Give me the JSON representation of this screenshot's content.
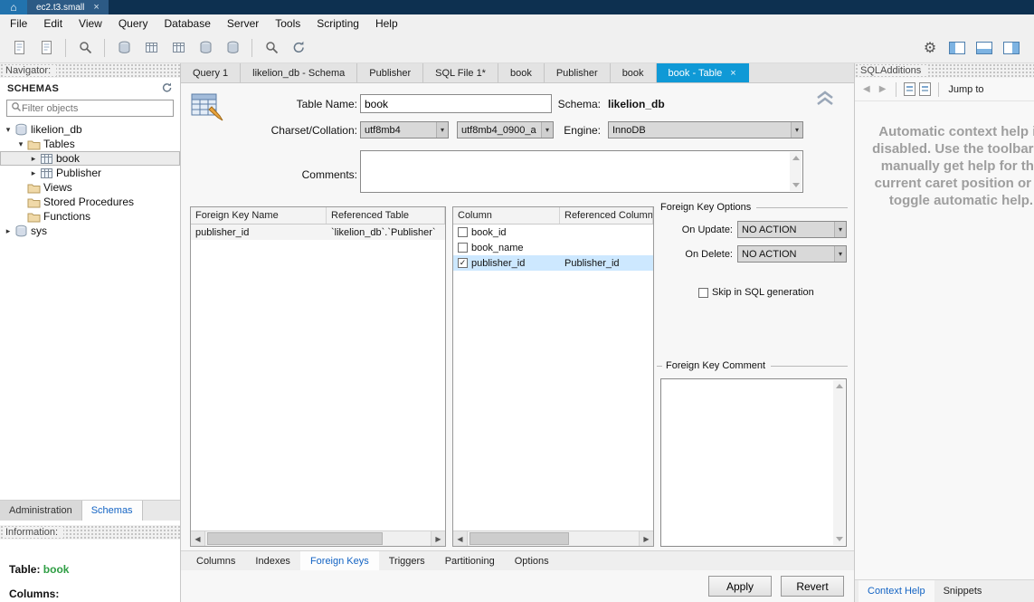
{
  "colors": {
    "titlebar": "#0d3050",
    "accent": "#0f99d6",
    "selection": "#cde8ff",
    "link": "#1464c4",
    "green": "#2f9e44"
  },
  "window": {
    "home_glyph": "⌂",
    "title_tab": "ec2.t3.small",
    "close_glyph": "×"
  },
  "menubar": {
    "items": [
      "File",
      "Edit",
      "View",
      "Query",
      "Database",
      "Server",
      "Tools",
      "Scripting",
      "Help"
    ]
  },
  "toolbar": {
    "left_icons": [
      {
        "name": "new-query-tab-icon",
        "glyph": "page"
      },
      {
        "name": "open-sql-script-icon",
        "glyph": "page"
      },
      {
        "separator": true
      },
      {
        "name": "inspect-database-icon",
        "glyph": "magnifier"
      },
      {
        "separator": true
      },
      {
        "name": "create-schema-icon",
        "glyph": "cylinder"
      },
      {
        "name": "create-table-icon",
        "glyph": "table"
      },
      {
        "name": "create-view-icon",
        "glyph": "table"
      },
      {
        "name": "create-procedure-icon",
        "glyph": "cylinder"
      },
      {
        "name": "create-function-icon",
        "glyph": "cylinder"
      },
      {
        "separator": true
      },
      {
        "name": "search-table-data-icon",
        "glyph": "magnifier"
      },
      {
        "name": "reconnect-dbms-icon",
        "glyph": "refresh"
      }
    ],
    "right_icons": [
      {
        "name": "preferences-gear-icon",
        "glyph": "gear"
      },
      {
        "name": "toggle-left-sidebar-icon",
        "glyph": "left"
      },
      {
        "name": "toggle-output-area-icon",
        "glyph": "bottom"
      },
      {
        "name": "toggle-right-sidebar-icon",
        "glyph": "right"
      }
    ]
  },
  "navigator": {
    "header": "Navigator:",
    "schemas_title": "SCHEMAS",
    "filter_placeholder": "Filter objects",
    "tree": [
      {
        "label": "likelion_db",
        "depth": 0,
        "expander": "open",
        "icon": "schema",
        "selected": false
      },
      {
        "label": "Tables",
        "depth": 1,
        "expander": "open",
        "icon": "folder",
        "selected": false
      },
      {
        "label": "book",
        "depth": 2,
        "expander": "closed",
        "icon": "table",
        "selected": true
      },
      {
        "label": "Publisher",
        "depth": 2,
        "expander": "closed",
        "icon": "table",
        "selected": false
      },
      {
        "label": "Views",
        "depth": 1,
        "expander": "none",
        "icon": "folder",
        "selected": false
      },
      {
        "label": "Stored Procedures",
        "depth": 1,
        "expander": "none",
        "icon": "folder",
        "selected": false
      },
      {
        "label": "Functions",
        "depth": 1,
        "expander": "none",
        "icon": "folder",
        "selected": false
      },
      {
        "label": "sys",
        "depth": 0,
        "expander": "closed",
        "icon": "schema",
        "selected": false
      }
    ],
    "bottom_tabs": [
      {
        "label": "Administration",
        "active": false
      },
      {
        "label": "Schemas",
        "active": true
      }
    ],
    "information_header": "Information:",
    "info_table_label": "Table:",
    "info_table_value": "book",
    "info_columns_label": "Columns:"
  },
  "editor": {
    "tabs": [
      {
        "label": "Query 1",
        "active": false
      },
      {
        "label": "likelion_db - Schema",
        "active": false
      },
      {
        "label": "Publisher",
        "active": false
      },
      {
        "label": "SQL File 1*",
        "active": false
      },
      {
        "label": "book",
        "active": false
      },
      {
        "label": "Publisher",
        "active": false
      },
      {
        "label": "book",
        "active": false
      },
      {
        "label": "book - Table",
        "active": true,
        "close_glyph": "×"
      }
    ],
    "form": {
      "table_name_label": "Table Name:",
      "table_name_value": "book",
      "schema_label": "Schema:",
      "schema_value": "likelion_db",
      "charset_label": "Charset/Collation:",
      "charset_value": "utf8mb4",
      "collation_value": "utf8mb4_0900_a",
      "engine_label": "Engine:",
      "engine_value": "InnoDB",
      "comments_label": "Comments:",
      "comments_value": ""
    },
    "fk_list": {
      "headers": [
        "Foreign Key Name",
        "Referenced Table"
      ],
      "rows": [
        {
          "name": "publisher_id",
          "referenced_table": "`likelion_db`.`Publisher`"
        }
      ]
    },
    "column_list": {
      "headers": [
        "Column",
        "Referenced Column"
      ],
      "rows": [
        {
          "column": "book_id",
          "referenced_column": "",
          "checked": false,
          "selected": false
        },
        {
          "column": "book_name",
          "referenced_column": "",
          "checked": false,
          "selected": false
        },
        {
          "column": "publisher_id",
          "referenced_column": "Publisher_id",
          "checked": true,
          "selected": true
        }
      ]
    },
    "fk_options": {
      "title": "Foreign Key Options",
      "on_update_label": "On Update:",
      "on_update_value": "NO ACTION",
      "on_delete_label": "On Delete:",
      "on_delete_value": "NO ACTION",
      "skip_sql_label": "Skip in SQL generation",
      "skip_sql_checked": false
    },
    "fk_comment": {
      "title": "Foreign Key Comment",
      "value": ""
    },
    "bottom_tabs": [
      {
        "label": "Columns",
        "active": false
      },
      {
        "label": "Indexes",
        "active": false
      },
      {
        "label": "Foreign Keys",
        "active": true
      },
      {
        "label": "Triggers",
        "active": false
      },
      {
        "label": "Partitioning",
        "active": false
      },
      {
        "label": "Options",
        "active": false
      }
    ],
    "apply_label": "Apply",
    "revert_label": "Revert"
  },
  "sql_additions": {
    "header": "SQLAdditions",
    "back_glyph": "◀",
    "forward_glyph": "▶",
    "jump_to_label": "Jump to",
    "help_text": "Automatic context help is disabled. Use the toolbar to manually get help for the current caret position or to toggle automatic help.",
    "bottom_tabs": [
      {
        "label": "Context Help",
        "active": true
      },
      {
        "label": "Snippets",
        "active": false
      }
    ]
  }
}
